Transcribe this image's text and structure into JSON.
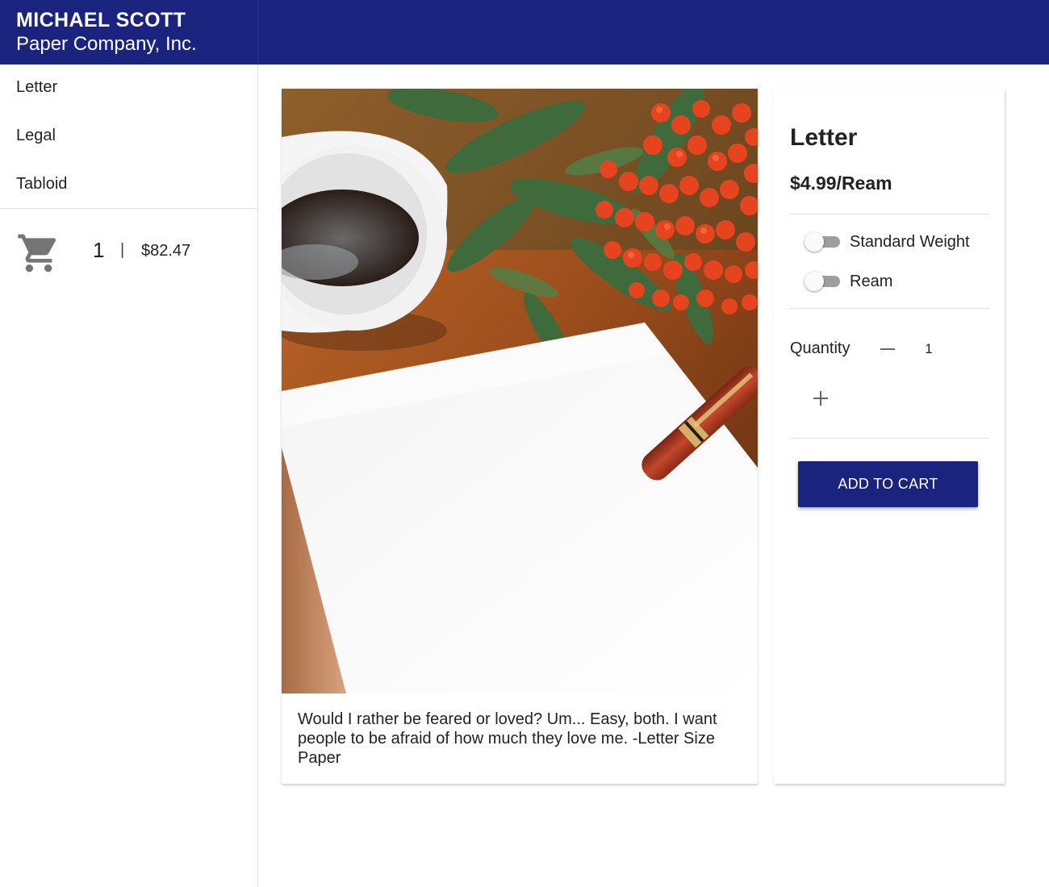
{
  "brand": {
    "title": "MICHAEL SCOTT",
    "subtitle": "Paper Company, Inc."
  },
  "sidebar": {
    "items": [
      {
        "label": "Letter"
      },
      {
        "label": "Legal"
      },
      {
        "label": "Tabloid"
      }
    ]
  },
  "cart": {
    "icon": "shopping-cart-icon",
    "count": "1",
    "separator": "|",
    "total": "$82.47"
  },
  "product": {
    "quote": "Would I rather be feared or loved? Um... Easy, both. I want people to be afraid of how much they love me. -Letter Size Paper"
  },
  "detail": {
    "name": "Letter",
    "price": "$4.99/Ream",
    "options": [
      {
        "label": "Standard Weight",
        "checked": false
      },
      {
        "label": "Ream",
        "checked": false
      }
    ],
    "quantity_label": "Quantity",
    "quantity": "1",
    "decrement_icon": "minus-icon",
    "increment_icon": "plus-icon",
    "add_to_cart_label": "ADD TO CART"
  },
  "colors": {
    "primary": "#1a237e",
    "toggle_track": "#9e9e9e",
    "toggle_thumb": "#fafafa"
  }
}
